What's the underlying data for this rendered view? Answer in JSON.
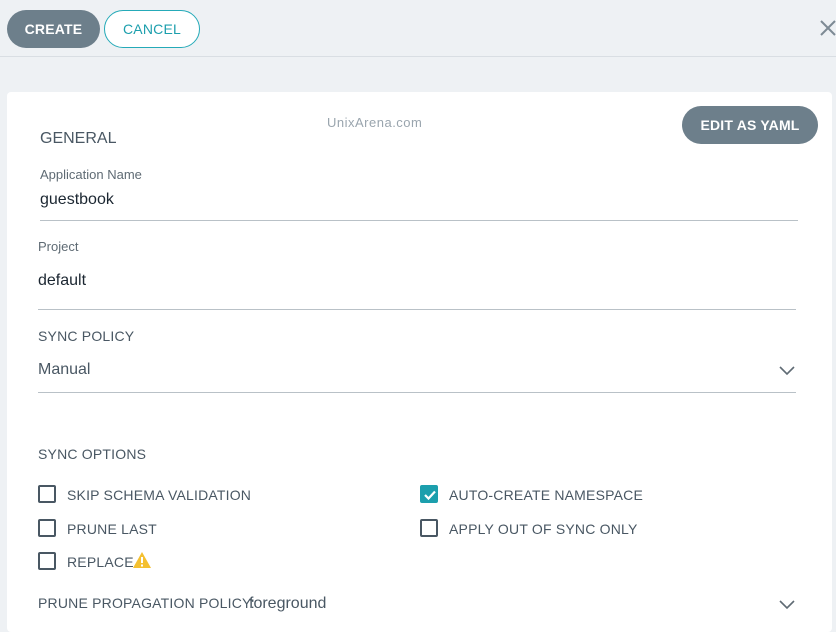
{
  "toolbar": {
    "create_label": "CREATE",
    "cancel_label": "CANCEL",
    "close_icon": "close-icon"
  },
  "form": {
    "edit_yaml_label": "EDIT AS YAML",
    "watermark": "UnixArena.com",
    "general_title": "GENERAL",
    "app_name_label": "Application Name",
    "app_name_value": "guestbook",
    "project_label": "Project",
    "project_value": "default",
    "sync_policy_label": "SYNC POLICY",
    "sync_policy_value": "Manual",
    "sync_options_title": "SYNC OPTIONS",
    "options": {
      "skip_schema": {
        "label": "SKIP SCHEMA VALIDATION",
        "checked": false
      },
      "auto_ns": {
        "label": "AUTO-CREATE NAMESPACE",
        "checked": true
      },
      "prune_last": {
        "label": "PRUNE LAST",
        "checked": false
      },
      "apply_oos": {
        "label": "APPLY OUT OF SYNC ONLY",
        "checked": false
      },
      "replace": {
        "label": "REPLACE",
        "checked": false,
        "icon": "warning-icon"
      }
    },
    "prune_policy_label": "PRUNE PROPAGATION POLICY:",
    "prune_policy_value": "foreground"
  },
  "colors": {
    "accent": "#1c9fad",
    "button_grey": "#6d7f8b",
    "warning": "#f4c030"
  }
}
